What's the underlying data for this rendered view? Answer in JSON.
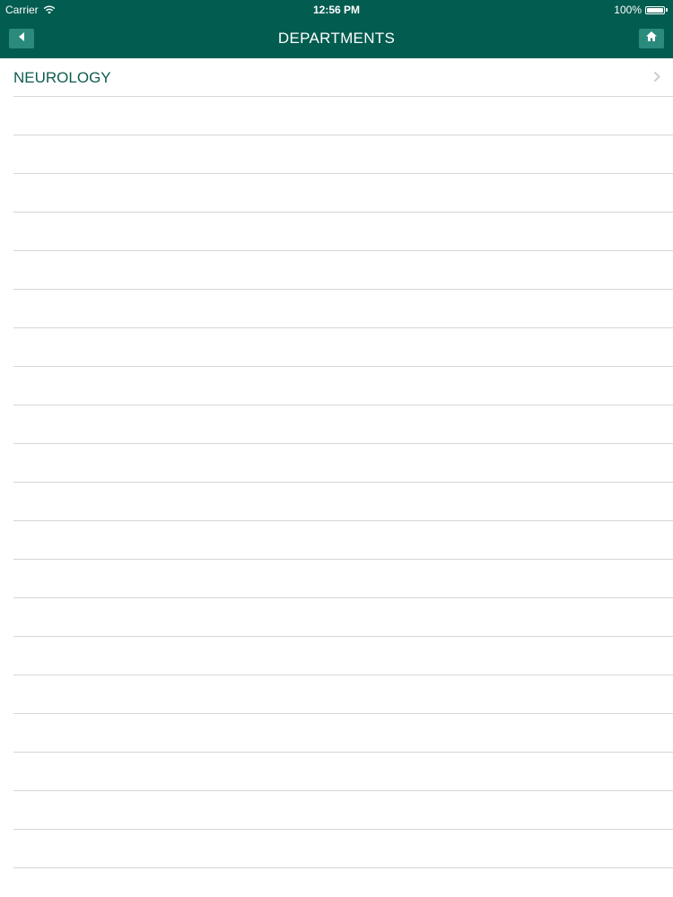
{
  "status_bar": {
    "carrier": "Carrier",
    "time": "12:56 PM",
    "battery": "100%",
    "battery_level": 1.0
  },
  "nav_bar": {
    "title": "DEPARTMENTS",
    "back_icon": "back-arrow-icon",
    "home_icon": "home-icon"
  },
  "list": {
    "items": [
      {
        "label": "NEUROLOGY",
        "icon": "chevron-right-icon"
      }
    ],
    "empty_rows": 21
  },
  "colors": {
    "header_bg": "#035c50",
    "nav_button_bg": "#2a8b7c",
    "item_text": "#0d5c4f",
    "separator": "#d6d6d6"
  }
}
